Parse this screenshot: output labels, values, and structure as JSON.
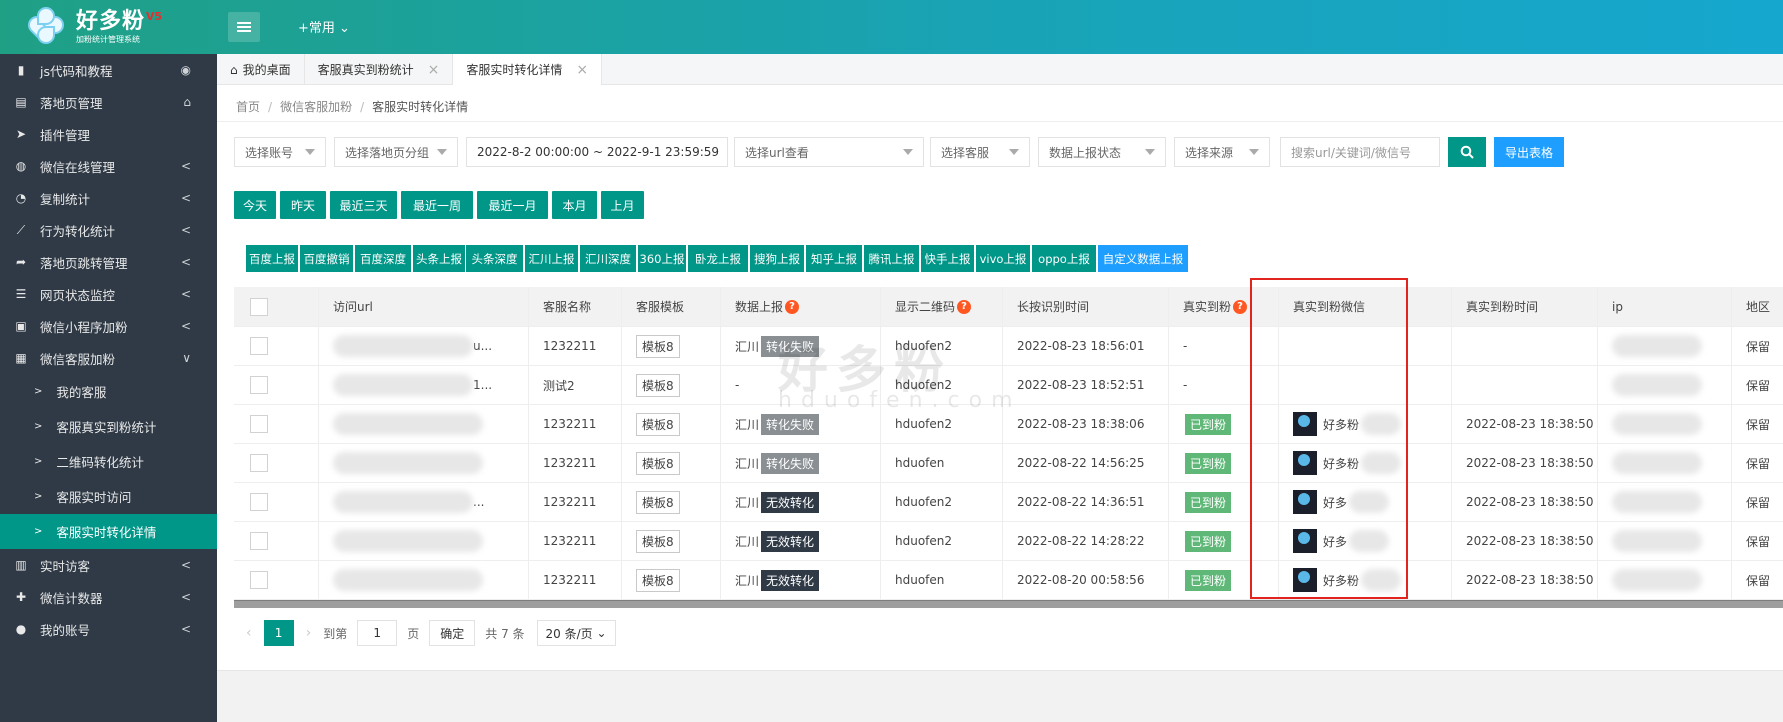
{
  "brand": {
    "title": "好多粉",
    "version": "V5",
    "subtitle": "加粉统计管理系统"
  },
  "header": {
    "common_menu": "+常用",
    "menu_toggle_icon": "hamburger-icon"
  },
  "sidebar": {
    "items": [
      {
        "label": "js代码和教程",
        "icon": "bookmark-icon",
        "right": "◉"
      },
      {
        "label": "落地页管理",
        "icon": "page-icon",
        "right": "⌂"
      },
      {
        "label": "插件管理",
        "icon": "send-icon",
        "right": ""
      },
      {
        "label": "微信在线管理",
        "icon": "wechat-icon",
        "right": "<"
      },
      {
        "label": "复制统计",
        "icon": "pie-icon",
        "right": "<"
      },
      {
        "label": "行为转化统计",
        "icon": "line-chart-icon",
        "right": "<"
      },
      {
        "label": "落地页跳转管理",
        "icon": "share-icon",
        "right": "<"
      },
      {
        "label": "网页状态监控",
        "icon": "server-icon",
        "right": "<"
      },
      {
        "label": "微信小程序加粉",
        "icon": "miniapp-icon",
        "right": "<"
      },
      {
        "label": "微信客服加粉",
        "icon": "service-icon",
        "right": "∨"
      }
    ],
    "subitems": [
      {
        "label": "我的客服"
      },
      {
        "label": "客服真实到粉统计"
      },
      {
        "label": "二维码转化统计"
      },
      {
        "label": "客服实时访问"
      },
      {
        "label": "客服实时转化详情"
      }
    ],
    "bottom_items": [
      {
        "label": "实时访客",
        "icon": "bar-chart-icon",
        "right": "<"
      },
      {
        "label": "微信计数器",
        "icon": "puzzle-icon",
        "right": "<"
      },
      {
        "label": "我的账号",
        "icon": "user-icon",
        "right": "<"
      }
    ]
  },
  "tabs": [
    {
      "label": "我的桌面",
      "icon": "home-icon"
    },
    {
      "label": "客服真实到粉统计",
      "close": "×"
    },
    {
      "label": "客服实时转化详情",
      "close": "×"
    }
  ],
  "breadcrumb": {
    "home": "首页",
    "parent": "微信客服加粉",
    "current": "客服实时转化详情",
    "sep": "/"
  },
  "filters": {
    "account": "选择账号",
    "landing_group": "选择落地页分组",
    "date_range": "2022-8-2 00:00:00 ~ 2022-9-1 23:59:59",
    "url": "选择url查看",
    "service": "选择客服",
    "report_status": "数据上报状态",
    "source": "选择来源",
    "search_placeholder": "搜索url/关键词/微信号",
    "export": "导出表格"
  },
  "quick_dates": [
    "今天",
    "昨天",
    "最近三天",
    "最近一周",
    "最近一月",
    "本月",
    "上月"
  ],
  "report_buttons": [
    "百度上报",
    "百度撤销",
    "百度深度",
    "头条上报",
    "头条深度",
    "汇川上报",
    "汇川深度",
    "360上报",
    "卧龙上报",
    "搜狗上报",
    "知乎上报",
    "腾讯上报",
    "快手上报",
    "vivo上报",
    "oppo上报",
    "自定义数据上报"
  ],
  "table": {
    "headers": {
      "url": "访问url",
      "service_name": "客服名称",
      "template": "客服模板",
      "report": "数据上报",
      "qrcode": "显示二维码",
      "long_press": "长按识别时间",
      "real_fan": "真实到粉",
      "real_wechat": "真实到粉微信",
      "real_time": "真实到粉时间",
      "ip": "ip",
      "region": "地区"
    },
    "rows": [
      {
        "url_tail": "u...",
        "service_name": "1232211",
        "template": "模板8",
        "report_prefix": "汇川",
        "report_badge": "转化失败",
        "report_kind": "fail",
        "qrcode": "hduofen2",
        "long_press": "2022-08-23 18:56:01",
        "real_fan": "-",
        "wechat": "",
        "real_time": "",
        "region": "保留"
      },
      {
        "url_tail": "1...",
        "service_name": "测试2",
        "template": "模板8",
        "report_prefix": "-",
        "report_badge": "",
        "report_kind": "",
        "qrcode": "hduofen2",
        "long_press": "2022-08-23 18:52:51",
        "real_fan": "-",
        "wechat": "",
        "real_time": "",
        "region": "保留"
      },
      {
        "url_tail": "",
        "service_name": "1232211",
        "template": "模板8",
        "report_prefix": "汇川",
        "report_badge": "转化失败",
        "report_kind": "fail",
        "qrcode": "hduofen2",
        "long_press": "2022-08-23 18:38:06",
        "real_fan": "已到粉",
        "wechat": "好多粉",
        "real_time": "2022-08-23 18:38:50",
        "region": "保留"
      },
      {
        "url_tail": "",
        "service_name": "1232211",
        "template": "模板8",
        "report_prefix": "汇川",
        "report_badge": "转化失败",
        "report_kind": "fail",
        "qrcode": "hduofen",
        "long_press": "2022-08-22 14:56:25",
        "real_fan": "已到粉",
        "wechat": "好多粉",
        "real_time": "2022-08-23 18:38:50",
        "region": "保留"
      },
      {
        "url_tail": "...",
        "service_name": "1232211",
        "template": "模板8",
        "report_prefix": "汇川",
        "report_badge": "无效转化",
        "report_kind": "void",
        "qrcode": "hduofen2",
        "long_press": "2022-08-22 14:36:51",
        "real_fan": "已到粉",
        "wechat": "好多",
        "real_time": "2022-08-23 18:38:50",
        "region": "保留"
      },
      {
        "url_tail": "",
        "service_name": "1232211",
        "template": "模板8",
        "report_prefix": "汇川",
        "report_badge": "无效转化",
        "report_kind": "void",
        "qrcode": "hduofen2",
        "long_press": "2022-08-22 14:28:22",
        "real_fan": "已到粉",
        "wechat": "好多",
        "real_time": "2022-08-23 18:38:50",
        "region": "保留"
      },
      {
        "url_tail": "",
        "service_name": "1232211",
        "template": "模板8",
        "report_prefix": "汇川",
        "report_badge": "无效转化",
        "report_kind": "void",
        "qrcode": "hduofen",
        "long_press": "2022-08-20 00:58:56",
        "real_fan": "已到粉",
        "wechat": "好多粉",
        "real_time": "2022-08-23 18:38:50",
        "region": "保留"
      }
    ]
  },
  "pager": {
    "current": "1",
    "goto_label": "到第",
    "goto_value": "1",
    "page_unit": "页",
    "confirm": "确定",
    "total": "共 7 条",
    "page_size": "20 条/页"
  },
  "watermark": {
    "main": "好多粉",
    "sub": "hduofen.com"
  },
  "colors": {
    "primary": "#009688",
    "blue": "#1e9fff",
    "sidebar": "#2f3a46",
    "highlight_box": "#e2241f",
    "ok": "#5fb878"
  }
}
